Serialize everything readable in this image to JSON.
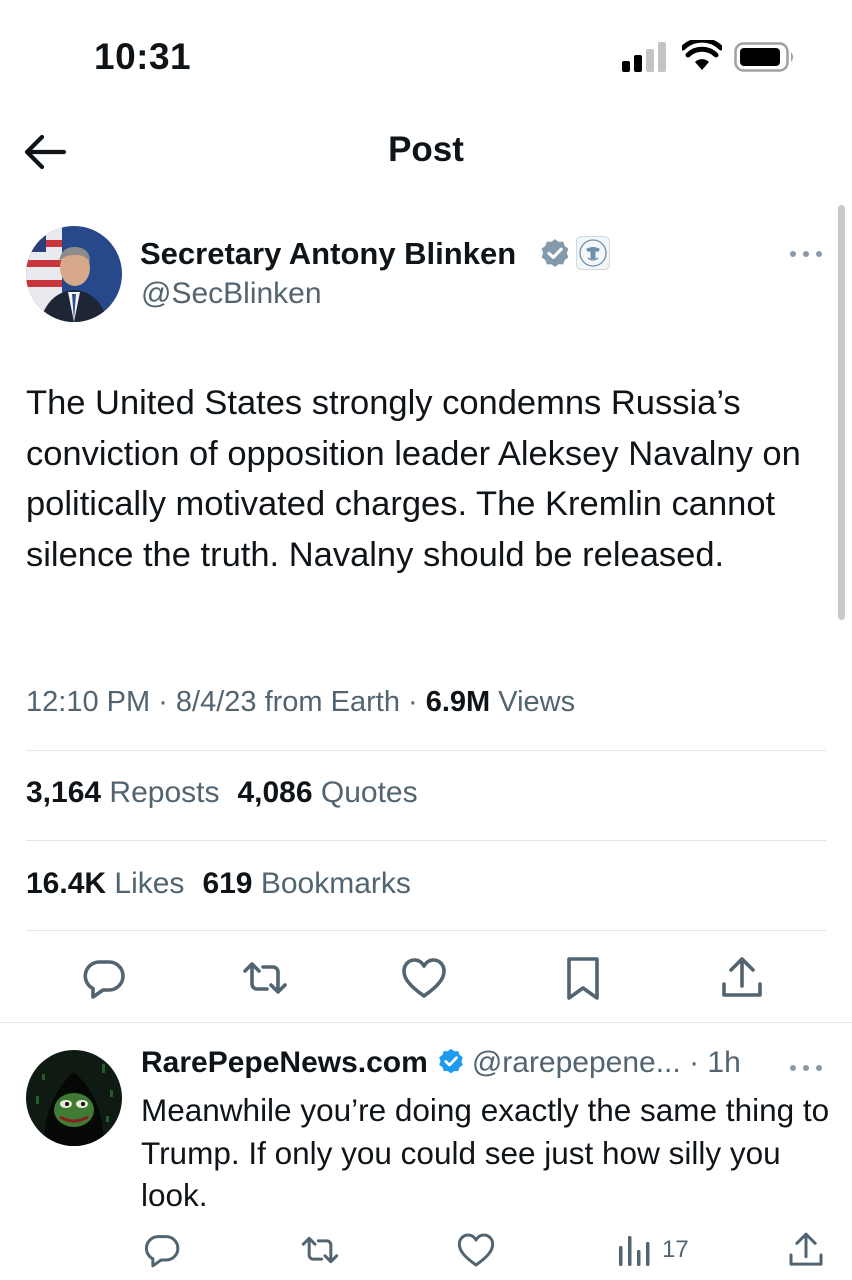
{
  "status_bar": {
    "time": "10:31"
  },
  "header": {
    "title": "Post"
  },
  "post": {
    "author_name": "Secretary Antony Blinken",
    "author_handle": "@SecBlinken",
    "text": "The United States strongly condemns Russia’s conviction of opposition leader Aleksey Navalny on politically motivated charges. The Kremlin cannot silence the truth. Navalny should be released.",
    "meta_time": "12:10 PM · 8/4/23 from Earth · ",
    "views_count": "6.9M",
    "views_label": " Views",
    "reposts_count": "3,164",
    "reposts_label": " Reposts",
    "quotes_count": "4,086",
    "quotes_label": " Quotes",
    "likes_count": "16.4K",
    "likes_label": " Likes",
    "bookmarks_count": "619",
    "bookmarks_label": " Bookmarks"
  },
  "reply": {
    "author_name": "RarePepeNews.com",
    "author_handle": "@rarepepene...",
    "time": " · 1h",
    "text": "Meanwhile you’re doing exactly the same thing to Trump. If only you could see just how silly you look.",
    "views_count": "17"
  },
  "icons": {
    "back": "arrow-left-icon",
    "verified_gray": "verified-badge-gray-icon",
    "affiliation": "us-state-department-seal-icon",
    "verified_blue": "verified-badge-blue-icon",
    "reply": "reply-bubble-icon",
    "repost": "repost-icon",
    "like": "heart-icon",
    "bookmark": "bookmark-icon",
    "share": "share-icon",
    "views": "views-bars-icon",
    "more": "more-dots-icon"
  },
  "colors": {
    "text": "#0f1419",
    "secondary": "#536471",
    "verified_blue": "#1d9bf0",
    "verified_gray": "#829aab",
    "divider": "#e3e6e8"
  }
}
